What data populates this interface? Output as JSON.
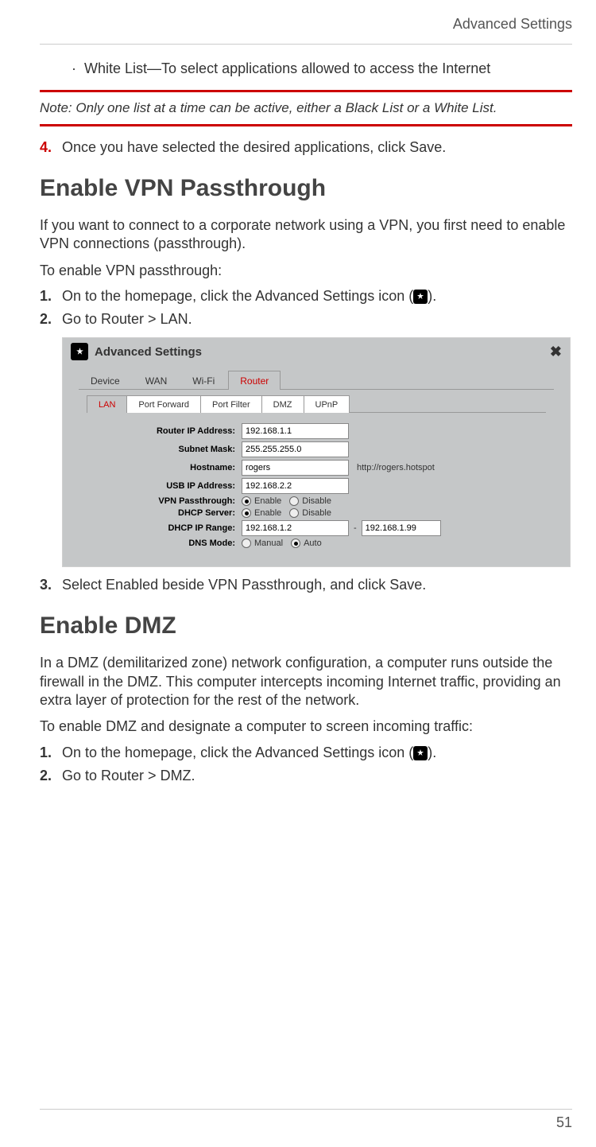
{
  "header": {
    "title": "Advanced Settings"
  },
  "bullet": {
    "prefix": "White List",
    "dash": "—",
    "text": "To select applications allowed to access the Internet"
  },
  "note": {
    "label": "Note:",
    "text": "Only one list at a time can be active, either a Black List or a White List."
  },
  "step4": {
    "num": "4.",
    "text": "Once you have selected the desired applications, click Save."
  },
  "vpn": {
    "heading": "Enable VPN Passthrough",
    "intro": "If you want to connect to a corporate network using a VPN, you first need to enable VPN connections (passthrough).",
    "lead": "To enable VPN passthrough:",
    "s1": {
      "num": "1.",
      "pre": "On to the homepage, click the Advanced Settings icon (",
      "post": ")."
    },
    "s2": {
      "num": "2.",
      "text": "Go to Router > LAN."
    },
    "s3": {
      "num": "3.",
      "text": "Select Enabled beside VPN Passthrough, and click Save."
    }
  },
  "dmz": {
    "heading": "Enable DMZ",
    "intro": "In a DMZ (demilitarized zone) network configuration, a computer runs outside the firewall in the DMZ. This computer intercepts incoming Internet traffic, providing an extra layer of protection for the rest of the network.",
    "lead": "To enable DMZ and designate a computer to screen incoming traffic:",
    "s1": {
      "num": "1.",
      "pre": "On to the homepage, click the Advanced Settings icon (",
      "post": ")."
    },
    "s2": {
      "num": "2.",
      "text": "Go to Router > DMZ."
    }
  },
  "screenshot": {
    "title": "Advanced Settings",
    "tabs": [
      "Device",
      "WAN",
      "Wi-Fi",
      "Router"
    ],
    "active_tab": "Router",
    "subtabs": [
      "LAN",
      "Port Forward",
      "Port Filter",
      "DMZ",
      "UPnP"
    ],
    "active_subtab": "LAN",
    "fields": {
      "router_ip": {
        "label": "Router IP Address:",
        "value": "192.168.1.1"
      },
      "subnet": {
        "label": "Subnet Mask:",
        "value": "255.255.255.0"
      },
      "hostname": {
        "label": "Hostname:",
        "value": "rogers",
        "note": "http://rogers.hotspot"
      },
      "usb_ip": {
        "label": "USB IP Address:",
        "value": "192.168.2.2"
      },
      "vpn": {
        "label": "VPN Passthrough:",
        "opts": [
          "Enable",
          "Disable"
        ],
        "selected": "Enable"
      },
      "dhcp": {
        "label": "DHCP Server:",
        "opts": [
          "Enable",
          "Disable"
        ],
        "selected": "Enable"
      },
      "range": {
        "label": "DHCP IP Range:",
        "from": "192.168.1.2",
        "to": "192.168.1.99"
      },
      "dns": {
        "label": "DNS Mode:",
        "opts": [
          "Manual",
          "Auto"
        ],
        "selected": "Auto"
      }
    }
  },
  "footer": {
    "page": "51"
  }
}
